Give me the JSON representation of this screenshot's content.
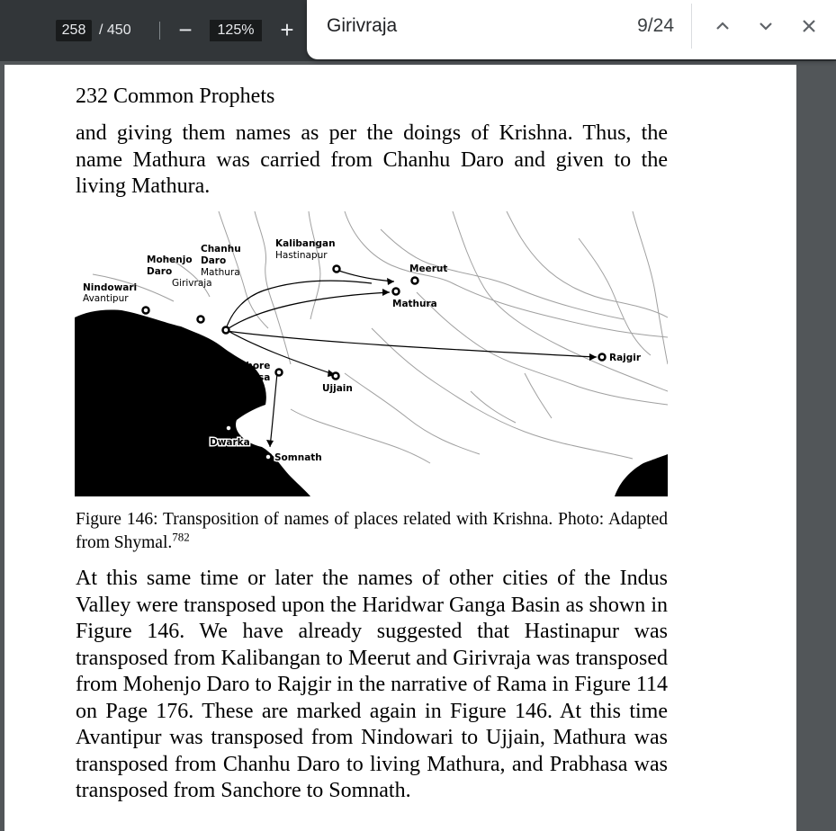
{
  "toolbar": {
    "page_current": "258",
    "page_total": "/ 450",
    "zoom_out": "−",
    "zoom_level": "125%",
    "zoom_in": "+"
  },
  "find": {
    "query": "Girivraja",
    "count": "9/24",
    "prev_icon": "chevron-up-icon",
    "next_icon": "chevron-down-icon",
    "close_icon": "close-icon"
  },
  "page": {
    "header": "232 Common Prophets",
    "paragraph1": "and giving them names as per the doings of Krishna. Thus, the name Mathura was carried from Chanhu Daro and given to the living Mathura.",
    "caption": "Figure 146: Transposition of names of places related with Krishna. Photo: Adapted from Shymal.",
    "caption_ref": "782",
    "paragraph2": "At this same time or later the names of other cities of the Indus Valley were transposed upon the Haridwar Ganga Basin as shown in Figure 146. We have already suggested that Hastinapur was transposed from Kalibangan to Meerut and Girivraja was transposed from Mohenjo Daro to Rajgir in the narrative of Rama in Figure 114 on Page 176. These are marked again in Figure 146. At this time Avantipur was transposed from Nindowari to Ujjain, Mathura was transposed from Chanhu Daro to living Mathura, and Prabhasa was transposed from Sanchore to Somnath."
  },
  "map_labels": {
    "kalibangan": "Kalibangan",
    "hastinapur": "Hastinapur",
    "chanhu": "Chanhu",
    "daro_c": "Daro",
    "mathura_c": "Mathura",
    "mohenjo": "Mohenjo",
    "daro_m": "Daro",
    "girivraja": "Girivraja",
    "nindowari": "Nindowari",
    "avantipur": "Avantipur",
    "meerut": "Meerut",
    "mathura": "Mathura",
    "rajgir": "Rajgir",
    "sanchore": "Sanchore",
    "prabhasa": "Prabhasa",
    "ujjain": "Ujjain",
    "dwarka": "Dwarka",
    "somnath": "Somnath"
  },
  "colors": {
    "toolbar_bg": "#323639",
    "viewer_bg": "#525659",
    "sea": "#000000",
    "rivers": "#9a9a9a"
  }
}
